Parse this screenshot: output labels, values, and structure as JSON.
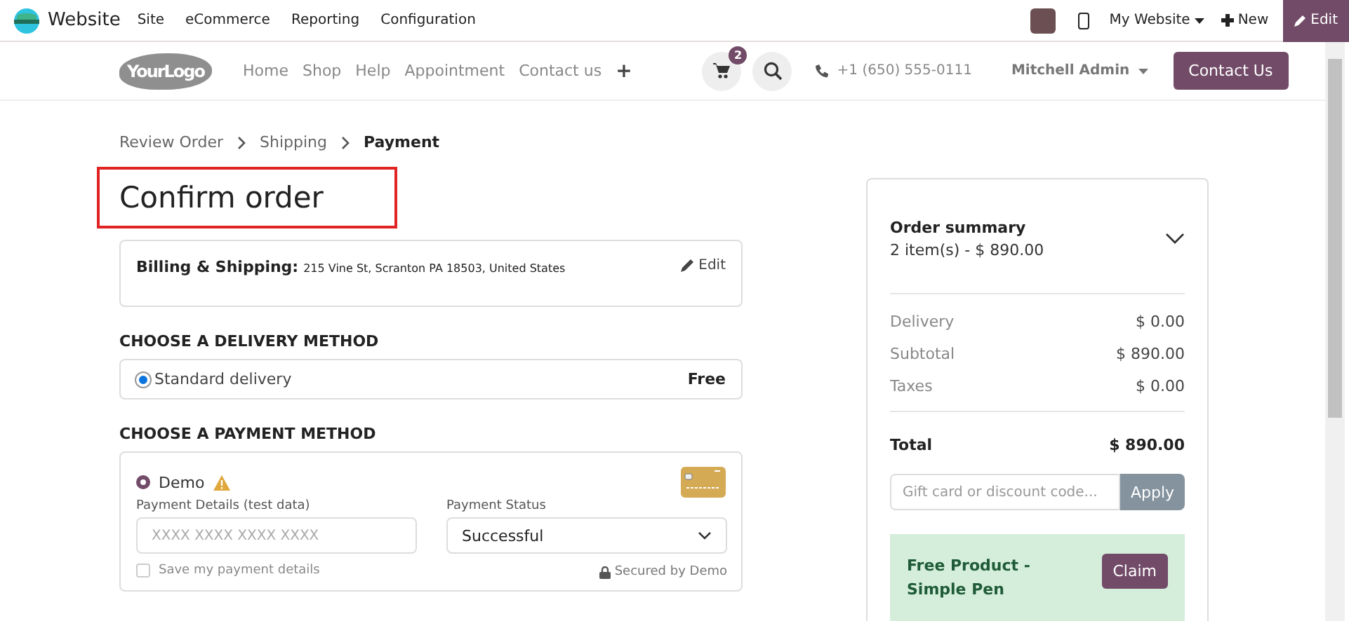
{
  "admin_bar": {
    "app_name": "Website",
    "menu": [
      "Site",
      "eCommerce",
      "Reporting",
      "Configuration"
    ],
    "website_switcher": "My Website",
    "new_button": "New",
    "edit_button": "Edit"
  },
  "site_header": {
    "logo": "YourLogo",
    "nav": [
      "Home",
      "Shop",
      "Help",
      "Appointment",
      "Contact us"
    ],
    "add_menu": "+",
    "cart_count": "2",
    "phone": "+1 (650) 555-0111",
    "user": "Mitchell Admin",
    "contact_button": "Contact Us"
  },
  "breadcrumb": [
    {
      "label": "Review Order",
      "selected": false
    },
    {
      "label": "Shipping",
      "selected": false
    },
    {
      "label": "Payment",
      "selected": true
    }
  ],
  "page_title": "Confirm order",
  "address": {
    "label": "Billing & Shipping:",
    "value": "215 Vine St, Scranton PA 18503, United States",
    "edit": "Edit"
  },
  "delivery": {
    "heading": "CHOOSE A DELIVERY METHOD",
    "options": [
      {
        "label": "Standard delivery",
        "price": "Free",
        "selected": true
      }
    ]
  },
  "payment": {
    "heading": "CHOOSE A PAYMENT METHOD",
    "options": [
      {
        "label": "Demo",
        "selected": true
      }
    ],
    "details_label": "Payment Details (test data)",
    "details_placeholder": "XXXX XXXX XXXX XXXX",
    "status_label": "Payment Status",
    "status_value": "Successful",
    "save_label": "Save my payment details",
    "save_checked": false,
    "secured": "Secured by Demo"
  },
  "summary": {
    "title": "Order summary",
    "items": "2 item(s) -  $ 890.00",
    "expanded": false,
    "lines": [
      {
        "label": "Delivery",
        "value": "$ 0.00"
      },
      {
        "label": "Subtotal",
        "value": "$ 890.00"
      },
      {
        "label": "Taxes",
        "value": "$ 0.00"
      }
    ],
    "total_label": "Total",
    "total_value": "$ 890.00",
    "code_placeholder": "Gift card or discount code...",
    "apply": "Apply",
    "reward": {
      "title": "Free Product - Simple Pen",
      "claim": "Claim"
    }
  }
}
